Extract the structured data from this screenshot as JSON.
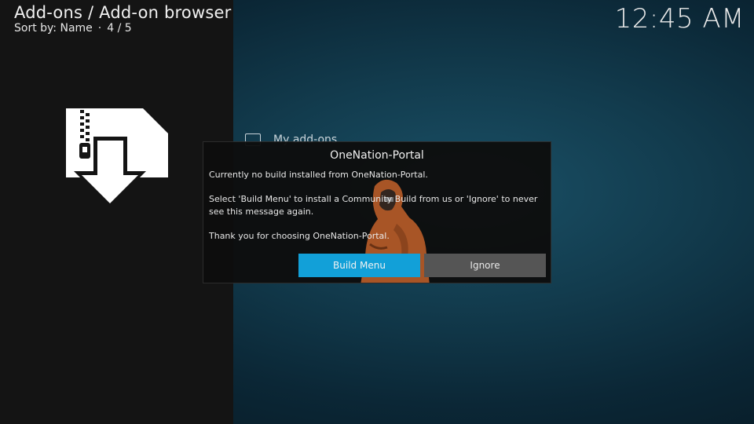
{
  "header": {
    "title": "Add-ons / Add-on browser",
    "sort_label": "Sort by: Name",
    "separator": "·",
    "position": "4 / 5"
  },
  "clock": "12:45 AM",
  "left_panel": {
    "icon": "addon-download-icon"
  },
  "background_list": {
    "item_label": "My add-ons",
    "item_icon": "monitor-icon"
  },
  "dialog": {
    "title": "OneNation-Portal",
    "line1": "Currently no build installed from OneNation-Portal.",
    "line2": "Select 'Build Menu' to install a Community Build from us or 'Ignore' to never see this message again.",
    "line3": "Thank you for choosing OneNation-Portal.",
    "build_menu_label": "Build Menu",
    "ignore_label": "Ignore",
    "accent_color": "#12a0d8"
  }
}
